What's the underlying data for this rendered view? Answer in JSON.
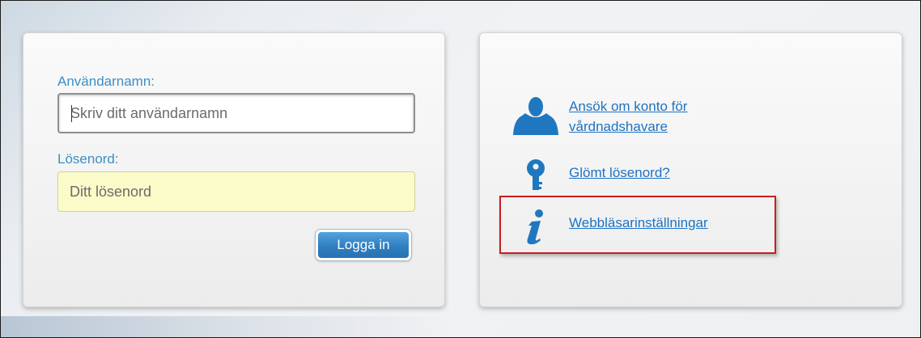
{
  "login": {
    "username_label": "Användarnamn:",
    "username_placeholder": "Skriv ditt användarnamn",
    "password_label": "Lösenord:",
    "password_placeholder": "Ditt lösenord",
    "login_button_label": "Logga in"
  },
  "links": {
    "items": [
      {
        "label": "Ansök om konto för vårdnadshavare",
        "icon": "person-icon"
      },
      {
        "label": "Glömt lösenord?",
        "icon": "key-icon"
      },
      {
        "label": "Webbläsarinställningar",
        "icon": "info-icon"
      }
    ]
  },
  "colors": {
    "label_blue": "#3b8fc6",
    "link_blue": "#1e73c3",
    "icon_blue": "#1f78bf",
    "button_blue": "#2f7fc2",
    "password_field_bg": "#fafbc9",
    "highlight_red": "#c81e1e"
  }
}
